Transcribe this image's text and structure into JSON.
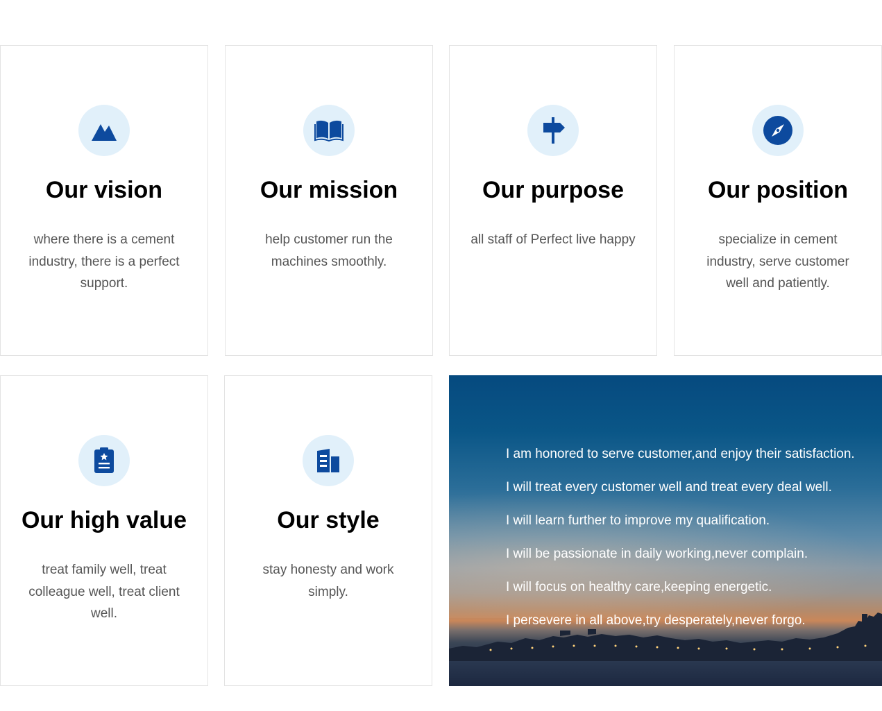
{
  "cards": [
    {
      "icon": "mountain-icon",
      "title": "Our vision",
      "text": "where there is a cement industry, there is a perfect support."
    },
    {
      "icon": "book-icon",
      "title": "Our mission",
      "text": "help customer run the machines smoothly."
    },
    {
      "icon": "signpost-icon",
      "title": "Our purpose",
      "text": "all staff of Perfect live happy"
    },
    {
      "icon": "compass-icon",
      "title": "Our position",
      "text": "specialize in cement industry, serve customer well and patiently."
    },
    {
      "icon": "clipboard-star-icon",
      "title": "Our high value",
      "text": "treat family well, treat colleague well, treat client well."
    },
    {
      "icon": "building-icon",
      "title": "Our style",
      "text": "stay honesty and work simply."
    }
  ],
  "pledges": [
    "I am honored to serve customer,and enjoy their satisfaction.",
    "I will treat every customer well and treat every deal well.",
    "I will learn further to improve my qualification.",
    "I will be passionate in daily working,never complain.",
    "I will focus on healthy care,keeping energetic.",
    "I persevere in all above,try desperately,never forgo."
  ],
  "colors": {
    "icon_blue": "#0d4a9e",
    "icon_circle_bg": "#e1f0fa",
    "card_border": "#e3e3e3",
    "body_text": "#555555"
  }
}
